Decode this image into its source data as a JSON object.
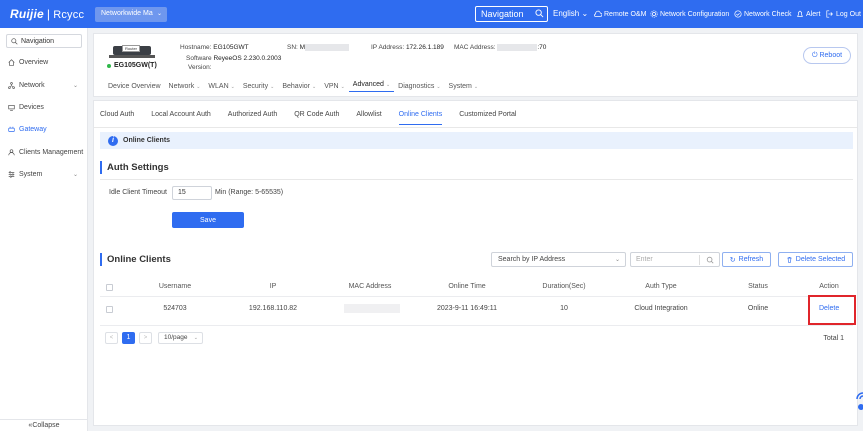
{
  "topbar": {
    "logo_main": "Ruijie",
    "logo_sep": "|",
    "logo_sub": "Rcycc",
    "network_select": "Networkwide Ma",
    "nav_search": "Navigation",
    "language": "English",
    "remote_om": "Remote O&M",
    "network_config": "Network Configuration",
    "network_check": "Network Check",
    "alert": "Alert",
    "logout": "Log Out"
  },
  "sidebar": {
    "nav_label": "Navigation",
    "items": [
      {
        "label": "Overview",
        "icon": "home-icon",
        "active": false
      },
      {
        "label": "Network",
        "icon": "network-icon",
        "active": false,
        "expandable": true
      },
      {
        "label": "Devices",
        "icon": "devices-icon",
        "active": false
      },
      {
        "label": "Gateway",
        "icon": "gateway-icon",
        "active": true
      },
      {
        "label": "Clients Management",
        "icon": "clients-icon",
        "active": false
      },
      {
        "label": "System",
        "icon": "system-icon",
        "active": false,
        "expandable": true
      }
    ],
    "collapse": "Collapse"
  },
  "device": {
    "router_label": "Router",
    "model": "EG105GW(T)",
    "hostname_label": "Hostname:",
    "hostname": "EG105GWT",
    "sn_label": "SN:",
    "sn_visible": "M",
    "ip_label": "IP Address:",
    "ip": "172.26.1.189",
    "mac_label": "MAC Address:",
    "mac_visible": ":70",
    "software_label": "Software",
    "software": "ReyeeOS 2.230.0.2003",
    "version_label": "Version:",
    "reboot": "Reboot"
  },
  "main_tabs": [
    "Device Overview",
    "Network",
    "WLAN",
    "Security",
    "Behavior",
    "VPN",
    "Advanced",
    "Diagnostics",
    "System"
  ],
  "main_tabs_active": "Advanced",
  "sub_tabs": [
    "Cloud Auth",
    "Local Account Auth",
    "Authorized Auth",
    "QR Code Auth",
    "Allowlist",
    "Online Clients",
    "Customized Portal"
  ],
  "sub_tabs_active": "Online Clients",
  "banner": "Online Clients",
  "auth_settings": {
    "title": "Auth Settings",
    "idle_label": "Idle Client Timeout",
    "idle_value": "15",
    "idle_unit": "Min (Range: 5-65535)",
    "save": "Save"
  },
  "online_clients": {
    "title": "Online Clients",
    "search_select": "Search by IP Address",
    "enter_placeholder": "Enter",
    "refresh": "Refresh",
    "delete_selected": "Delete Selected",
    "columns": [
      "Username",
      "IP",
      "MAC Address",
      "Online Time",
      "Duration(Sec)",
      "Auth Type",
      "Status",
      "Action"
    ],
    "rows": [
      {
        "username": "524703",
        "ip": "192.168.110.82",
        "mac": "",
        "online_time": "2023-9-11 16:49:11",
        "duration": "10",
        "auth_type": "Cloud Integration",
        "status": "Online",
        "action": "Delete"
      }
    ],
    "pagination": {
      "prev": "<",
      "current": "1",
      "next": ">",
      "per_page": "10/page",
      "total": "Total 1"
    }
  },
  "colors": {
    "accent": "#2f6cf0",
    "highlight": "#e0252b",
    "online_dot": "#2fb84a"
  }
}
